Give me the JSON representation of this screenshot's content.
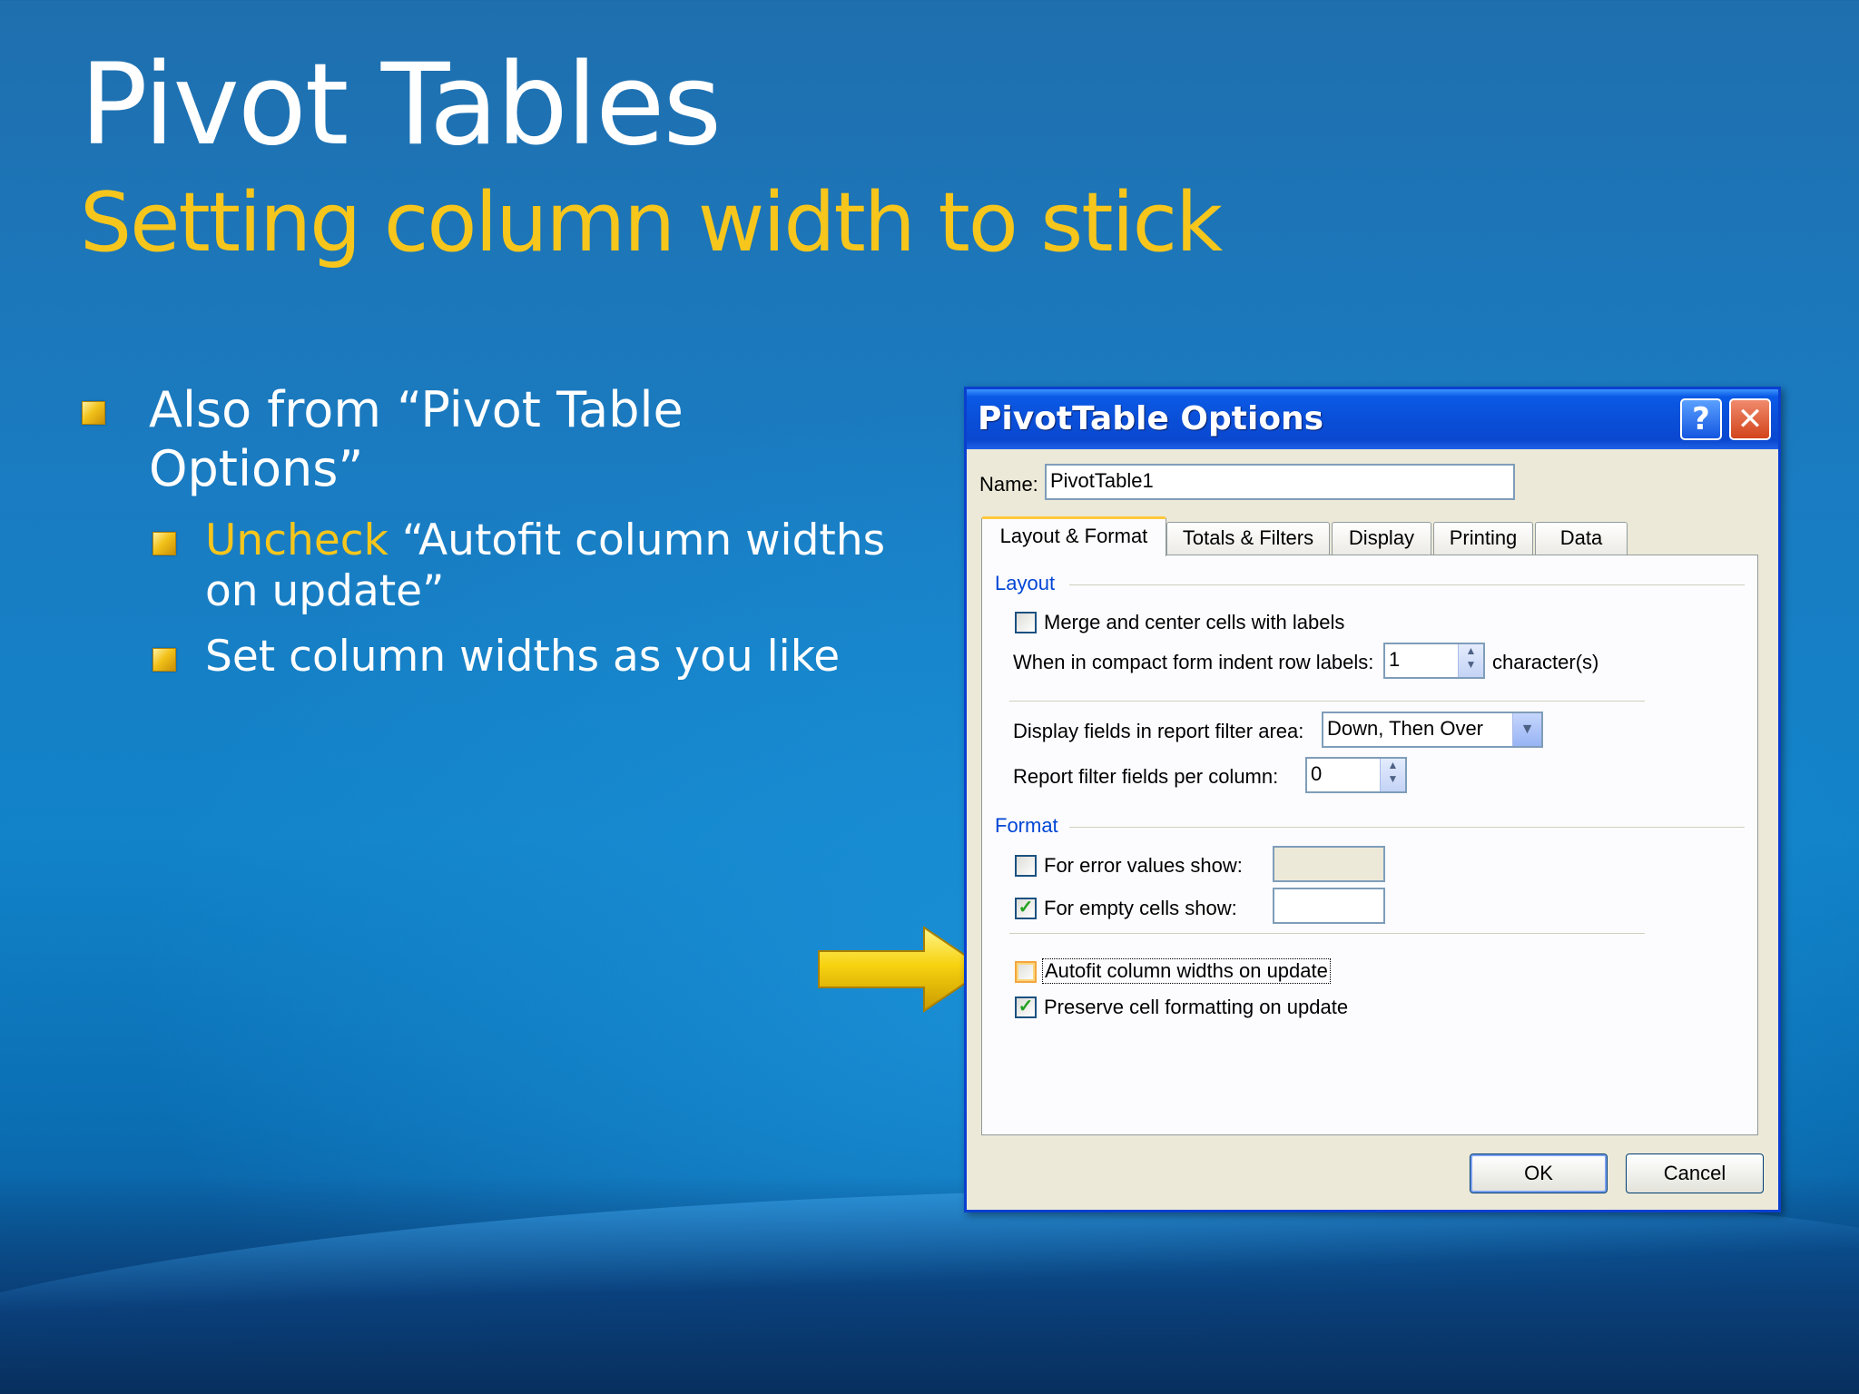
{
  "slide": {
    "title": "Pivot Tables",
    "subtitle": "Setting column width to stick",
    "bullet1": "Also from “Pivot Table Options”",
    "bullet2_highlight": "Uncheck",
    "bullet2_line1": " “Autofit column widths",
    "bullet2_line2": "on update”",
    "bullet3": "Set column widths as you like"
  },
  "dialog": {
    "title": "PivotTable Options",
    "help_glyph": "?",
    "close_glyph": "✕",
    "name_label": "Name:",
    "name_value": "PivotTable1",
    "tabs": [
      "Layout & Format",
      "Totals & Filters",
      "Display",
      "Printing",
      "Data"
    ],
    "layout_group": "Layout",
    "merge_label": "Merge and center cells with labels",
    "indent_label": "When in compact form indent row labels:",
    "indent_value": "1",
    "indent_unit": "character(s)",
    "display_fields_label": "Display fields in report filter area:",
    "display_fields_value": "Down, Then Over",
    "filter_fields_label": "Report filter fields per column:",
    "filter_fields_value": "0",
    "format_group": "Format",
    "error_values_label": "For error values show:",
    "empty_cells_label": "For empty cells show:",
    "autofit_label": "Autofit column widths on update",
    "preserve_label": "Preserve cell formatting on update",
    "check_glyph": "✓",
    "ok_label": "OK",
    "cancel_label": "Cancel"
  },
  "colors": {
    "accent_yellow": "#f6c61c",
    "xp_title_blue": "#0a4fd8",
    "group_heading_blue": "#0046d5"
  }
}
